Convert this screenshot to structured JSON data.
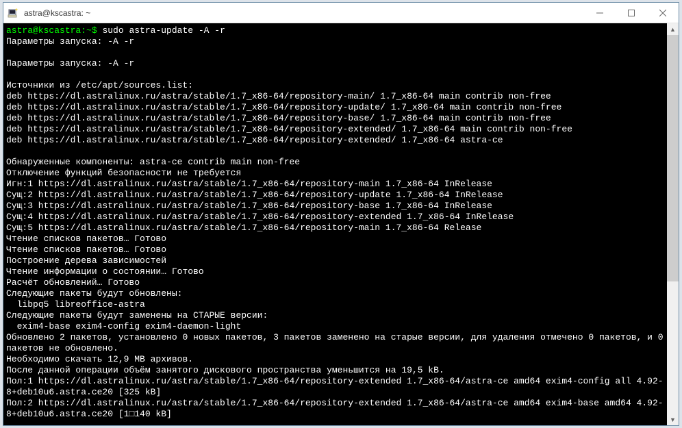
{
  "window": {
    "title": "astra@kscastra: ~"
  },
  "terminal": {
    "prompt_user": "astra@kscastra",
    "prompt_path": "~",
    "prompt_suffix": "$ ",
    "command": "sudo astra-update -A -r",
    "lines": [
      "Параметры запуска: -A -r",
      "",
      "Параметры запуска: -A -r",
      "",
      "Источники из /etc/apt/sources.list:",
      "deb https://dl.astralinux.ru/astra/stable/1.7_x86-64/repository-main/ 1.7_x86-64 main contrib non-free",
      "deb https://dl.astralinux.ru/astra/stable/1.7_x86-64/repository-update/ 1.7_x86-64 main contrib non-free",
      "deb https://dl.astralinux.ru/astra/stable/1.7_x86-64/repository-base/ 1.7_x86-64 main contrib non-free",
      "deb https://dl.astralinux.ru/astra/stable/1.7_x86-64/repository-extended/ 1.7_x86-64 main contrib non-free",
      "deb https://dl.astralinux.ru/astra/stable/1.7_x86-64/repository-extended/ 1.7_x86-64 astra-ce",
      "",
      "Обнаруженные компоненты: astra-ce contrib main non-free",
      "Отключение функций безопасности не требуется",
      "Игн:1 https://dl.astralinux.ru/astra/stable/1.7_x86-64/repository-main 1.7_x86-64 InRelease",
      "Сущ:2 https://dl.astralinux.ru/astra/stable/1.7_x86-64/repository-update 1.7_x86-64 InRelease",
      "Сущ:3 https://dl.astralinux.ru/astra/stable/1.7_x86-64/repository-base 1.7_x86-64 InRelease",
      "Сущ:4 https://dl.astralinux.ru/astra/stable/1.7_x86-64/repository-extended 1.7_x86-64 InRelease",
      "Сущ:5 https://dl.astralinux.ru/astra/stable/1.7_x86-64/repository-main 1.7_x86-64 Release",
      "Чтение списков пакетов… Готово",
      "Чтение списков пакетов… Готово",
      "Построение дерева зависимостей",
      "Чтение информации о состоянии… Готово",
      "Расчёт обновлений… Готово",
      "Следующие пакеты будут обновлены:",
      "  libpq5 libreoffice-astra",
      "Следующие пакеты будут заменены на СТАРЫЕ версии:",
      "  exim4-base exim4-config exim4-daemon-light",
      "Обновлено 2 пакетов, установлено 0 новых пакетов, 3 пакетов заменено на старые версии, для удаления отмечено 0 пакетов, и 0 пакетов не обновлено.",
      "Необходимо скачать 12,9 MB архивов.",
      "После данной операции объём занятого дискового пространства уменьшится на 19,5 kB.",
      "Пол:1 https://dl.astralinux.ru/astra/stable/1.7_x86-64/repository-extended 1.7_x86-64/astra-ce amd64 exim4-config all 4.92-8+deb10u6.astra.ce20 [325 kB]",
      "Пол:2 https://dl.astralinux.ru/astra/stable/1.7_x86-64/repository-extended 1.7_x86-64/astra-ce amd64 exim4-base amd64 4.92-8+deb10u6.astra.ce20 [1□140 kB]"
    ]
  }
}
